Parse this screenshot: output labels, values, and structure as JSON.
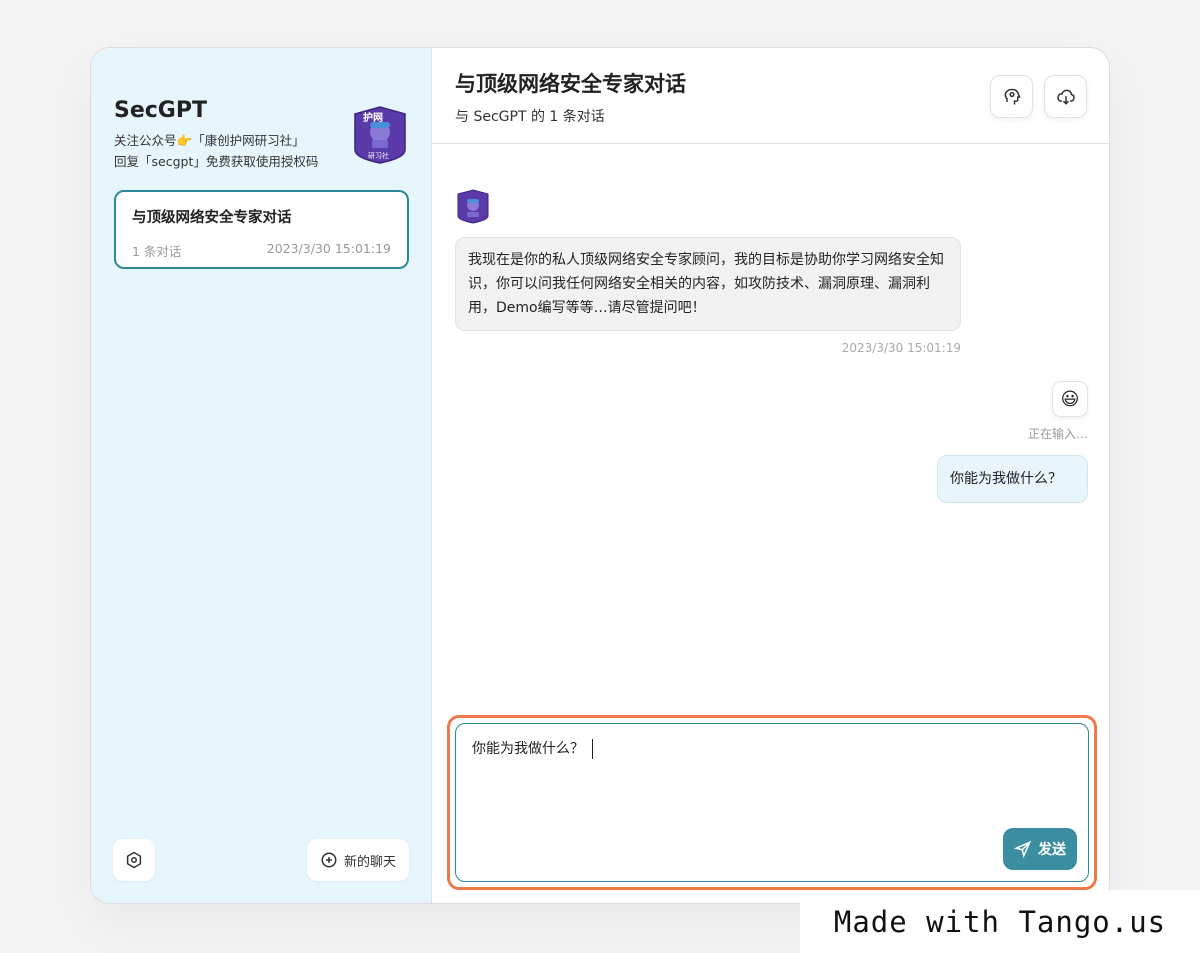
{
  "sidebar": {
    "brand_title": "SecGPT",
    "brand_sub_line1": "关注公众号👉「康创护网研习社」",
    "brand_sub_line2": "回复「secgpt」免费获取使用授权码",
    "logo_text_top": "护网",
    "logo_text_bottom": "研习社",
    "chat_items": [
      {
        "title": "与顶级网络安全专家对话",
        "count": "1 条对话",
        "time": "2023/3/30 15:01:19"
      }
    ],
    "new_chat_label": "新的聊天"
  },
  "header": {
    "title": "与顶级网络安全专家对话",
    "subtitle": "与 SecGPT 的 1 条对话"
  },
  "messages": {
    "bot_text": "我现在是你的私人顶级网络安全专家顾问，我的目标是协助你学习网络安全知识，你可以问我任何网络安全相关的内容，如攻防技术、漏洞原理、漏洞利用，Demo编写等等…请尽管提问吧！",
    "bot_time": "2023/3/30 15:01:19",
    "user_avatar_emoji": "😃",
    "typing_status": "正在输入…",
    "user_text": "你能为我做什么？"
  },
  "input": {
    "value": "你能为我做什么？",
    "send_label": "发送"
  },
  "watermark": "Made with Tango.us",
  "colors": {
    "sidebar_bg": "#e7f6fd",
    "accent": "#3a8ea0",
    "highlight": "#ee7a4a"
  }
}
